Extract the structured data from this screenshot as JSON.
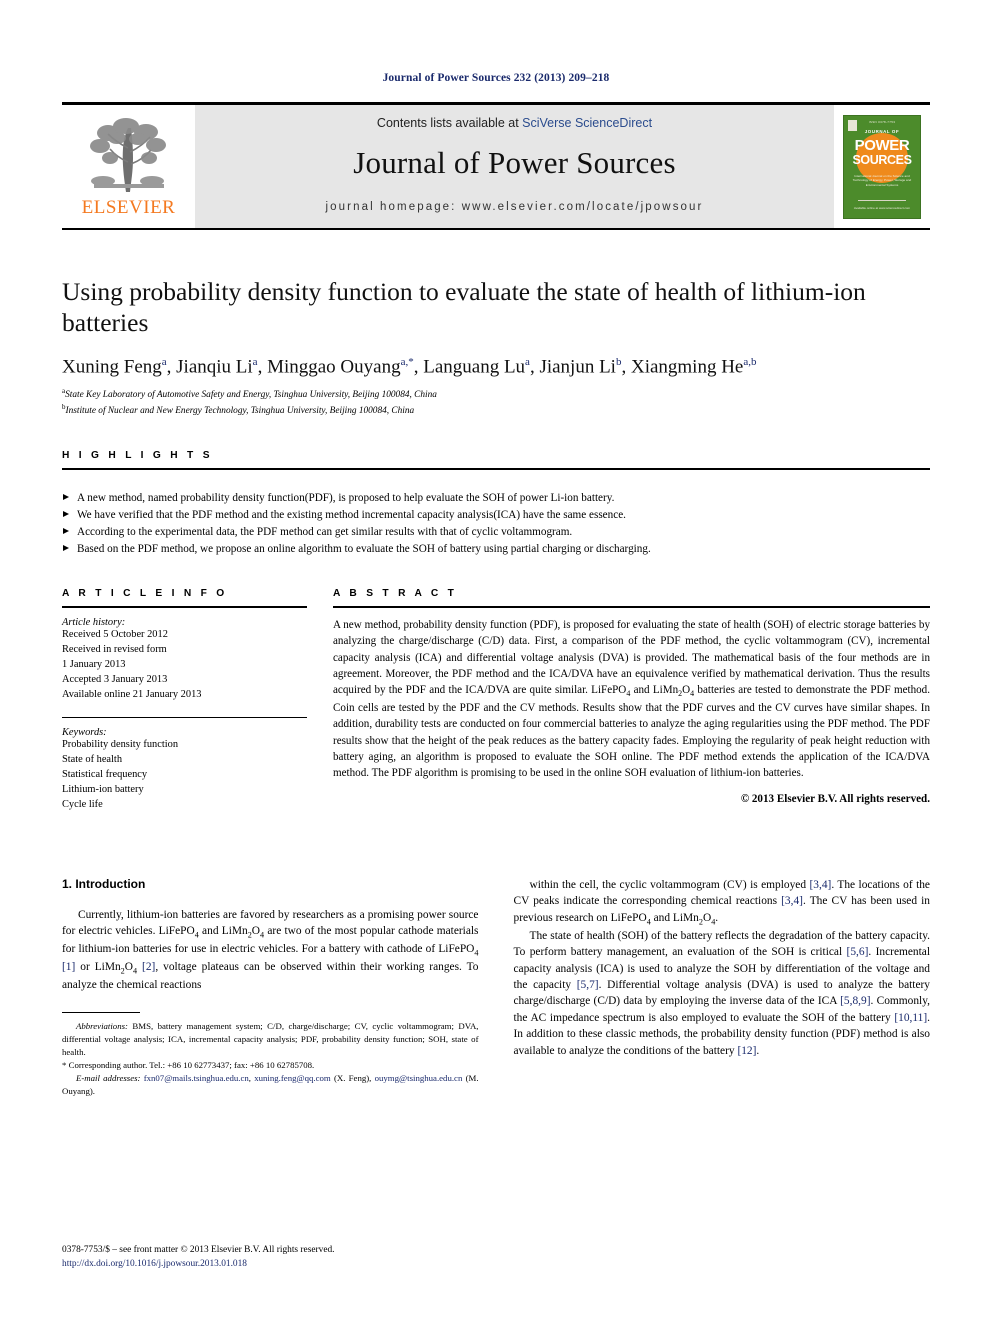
{
  "running_head": "Journal of Power Sources 232 (2013) 209–218",
  "masthead": {
    "contents_prefix": "Contents lists available at ",
    "contents_link": "SciVerse ScienceDirect",
    "journal_title": "Journal of Power Sources",
    "homepage": "journal homepage: www.elsevier.com/locate/jpowsour",
    "publisher_logo_text": "ELSEVIER",
    "cover": {
      "top_label": "ISSN 0378-7753",
      "journal_of": "JOURNAL OF",
      "power": "POWER",
      "sources": "SOURCES",
      "subtitle": "International Journal on the Science and Technology of Energy, Power, Storage and Environmental Systems",
      "bottom": "Available online at www.sciencedirect.com"
    }
  },
  "article": {
    "title": "Using probability density function to evaluate the state of health of lithium-ion batteries",
    "authors": [
      {
        "name": "Xuning Feng",
        "sup": "a"
      },
      {
        "name": "Jianqiu Li",
        "sup": "a"
      },
      {
        "name": "Minggao Ouyang",
        "sup": "a,*"
      },
      {
        "name": "Languang Lu",
        "sup": "a"
      },
      {
        "name": "Jianjun Li",
        "sup": "b"
      },
      {
        "name": "Xiangming He",
        "sup": "a,b"
      }
    ],
    "affiliations": [
      {
        "marker": "a",
        "text": "State Key Laboratory of Automotive Safety and Energy, Tsinghua University, Beijing 100084, China"
      },
      {
        "marker": "b",
        "text": "Institute of Nuclear and New Energy Technology, Tsinghua University, Beijing 100084, China"
      }
    ]
  },
  "highlights": {
    "heading": "H I G H L I G H T S",
    "items": [
      "A new method, named probability density function(PDF), is proposed to help evaluate the SOH of power Li-ion battery.",
      "We have verified that the PDF method and the existing method incremental capacity analysis(ICA) have the same essence.",
      "According to the experimental data, the PDF method can get similar results with that of cyclic voltammogram.",
      "Based on the PDF method, we propose an online algorithm to evaluate the SOH of battery using partial charging or discharging."
    ]
  },
  "article_info": {
    "heading": "A R T I C L E  I N F O",
    "history_label": "Article history:",
    "history": [
      "Received 5 October 2012",
      "Received in revised form",
      "1 January 2013",
      "Accepted 3 January 2013",
      "Available online 21 January 2013"
    ],
    "keywords_label": "Keywords:",
    "keywords": [
      "Probability density function",
      "State of health",
      "Statistical frequency",
      "Lithium-ion battery",
      "Cycle life"
    ]
  },
  "abstract": {
    "heading": "A B S T R A C T",
    "text": "A new method, probability density function (PDF), is proposed for evaluating the state of health (SOH) of electric storage batteries by analyzing the charge/discharge (C/D) data. First, a comparison of the PDF method, the cyclic voltammogram (CV), incremental capacity analysis (ICA) and differential voltage analysis (DVA) is provided. The mathematical basis of the four methods are in agreement. Moreover, the PDF method and the ICA/DVA have an equivalence verified by mathematical derivation. Thus the results acquired by the PDF and the ICA/DVA are quite similar. LiFePO4 and LiMn2O4 batteries are tested to demonstrate the PDF method. Coin cells are tested by the PDF and the CV methods. Results show that the PDF curves and the CV curves have similar shapes. In addition, durability tests are conducted on four commercial batteries to analyze the aging regularities using the PDF method. The PDF results show that the height of the peak reduces as the battery capacity fades. Employing the regularity of peak height reduction with battery aging, an algorithm is proposed to evaluate the SOH online. The PDF method extends the application of the ICA/DVA method. The PDF algorithm is promising to be used in the online SOH evaluation of lithium-ion batteries.",
    "copyright": "© 2013 Elsevier B.V. All rights reserved."
  },
  "introduction": {
    "heading": "1.  Introduction",
    "left_para_1": "Currently, lithium-ion batteries are favored by researchers as a promising power source for electric vehicles. LiFePO4 and LiMn2O4 are two of the most popular cathode materials for lithium-ion batteries for use in electric vehicles. For a battery with cathode of LiFePO4 [1] or LiMn2O4 [2], voltage plateaus can be observed within their working ranges. To analyze the chemical reactions",
    "right_para_1": "within the cell, the cyclic voltammogram (CV) is employed [3,4]. The locations of the CV peaks indicate the corresponding chemical reactions [3,4]. The CV has been used in previous research on LiFePO4 and LiMn2O4.",
    "right_para_2": "The state of health (SOH) of the battery reflects the degradation of the battery capacity. To perform battery management, an evaluation of the SOH is critical [5,6]. Incremental capacity analysis (ICA) is used to analyze the SOH by differentiation of the voltage and the capacity [5,7]. Differential voltage analysis (DVA) is used to analyze the battery charge/discharge (C/D) data by employing the inverse data of the ICA [5,8,9]. Commonly, the AC impedance spectrum is also employed to evaluate the SOH of the battery [10,11]. In addition to these classic methods, the probability density function (PDF) method is also available to analyze the conditions of the battery [12]."
  },
  "footnotes": {
    "abbreviations_label": "Abbreviations:",
    "abbreviations_text": "BMS, battery management system; C/D, charge/discharge; CV, cyclic voltammogram; DVA, differential voltage analysis; ICA, incremental capacity analysis; PDF, probability density function; SOH, state of health.",
    "corresponding": "* Corresponding author. Tel.: +86 10 62773437; fax: +86 10 62785708.",
    "email_label": "E-mail addresses:",
    "email_1": "fxn07@mails.tsinghua.edu.cn",
    "email_2": "xuning.feng@qq.com",
    "email_1_owner": "(X. Feng)",
    "email_3": "ouymg@tsinghua.edu.cn",
    "email_3_owner": "(M. Ouyang)."
  },
  "bottom": {
    "issn_line": "0378-7753/$ – see front matter © 2013 Elsevier B.V. All rights reserved.",
    "doi": "http://dx.doi.org/10.1016/j.jpowsour.2013.01.018"
  }
}
